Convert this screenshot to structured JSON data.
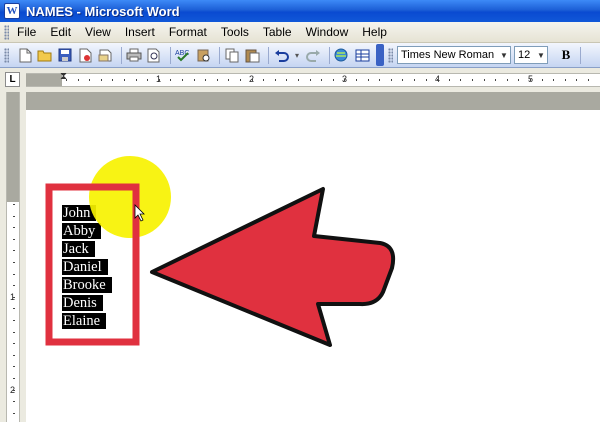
{
  "window": {
    "title": "NAMES - Microsoft Word",
    "app_icon_letter": "W"
  },
  "menu": {
    "items": [
      "File",
      "Edit",
      "View",
      "Insert",
      "Format",
      "Tools",
      "Table",
      "Window",
      "Help"
    ]
  },
  "toolbar": {
    "icons": [
      "new-document-icon",
      "open-folder-icon",
      "save-icon",
      "permission-icon",
      "email-icon",
      "print-icon",
      "print-preview-icon",
      "spelling-icon",
      "research-icon",
      "cut-icon",
      "copy-icon",
      "paste-icon",
      "undo-icon",
      "redo-icon",
      "hyperlink-icon",
      "tables-icon"
    ],
    "font_name": "Times New Roman",
    "font_size": "12",
    "bold_label": "B"
  },
  "ruler": {
    "tab_selector": "L",
    "h_numbers": [
      "1",
      "2",
      "3",
      "4",
      "5"
    ],
    "v_numbers": [
      "1",
      "2"
    ]
  },
  "document": {
    "selected_names": [
      "John",
      "Abby",
      "Jack",
      "Daniel",
      "Brooke",
      "Denis",
      "Elaine"
    ]
  },
  "annotations": {
    "highlight_color": "#f7f200",
    "arrow_color": "#e0313f",
    "box_color": "#e0313f"
  }
}
